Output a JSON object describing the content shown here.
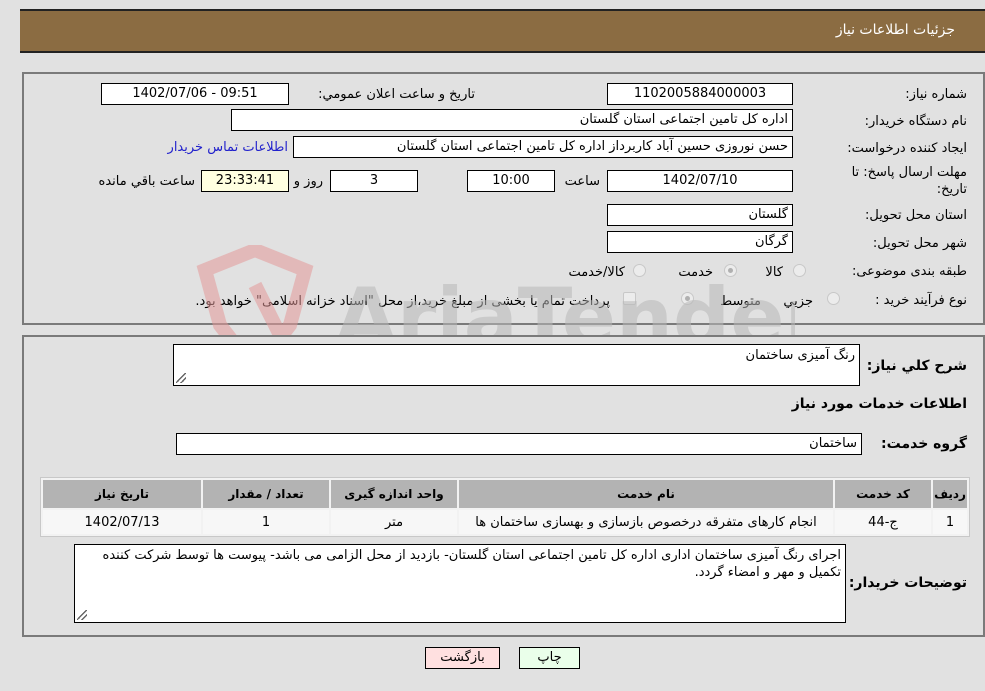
{
  "header": {
    "title": "جزئيات اطلاعات نياز"
  },
  "details": {
    "need_number_label": "شماره نياز:",
    "need_number": "1102005884000003",
    "announce_label": "تاريخ و ساعت اعلان عمومي:",
    "announce_value": "1402/07/06 - 09:51",
    "buyer_org_label": "نام دستگاه خريدار:",
    "buyer_org": "اداره کل تامین اجتماعی استان گلستان",
    "creator_label": "ايجاد کننده درخواست:",
    "creator": "حسن نوروزی حسین آباد کاربرداز اداره کل تامین اجتماعی استان گلستان",
    "contact_link": "اطلاعات تماس خريدار",
    "deadline_label_1": "مهلت ارسال پاسخ: تا",
    "deadline_label_2": "تاريخ:",
    "deadline_date": "1402/07/10",
    "time_label": "ساعت",
    "deadline_time": "10:00",
    "days_value": "3",
    "days_label": "روز و",
    "remaining_time": "23:33:41",
    "remaining_label": "ساعت باقي مانده",
    "province_label": "استان محل تحويل:",
    "province": "گلستان",
    "city_label": "شهر محل تحويل:",
    "city": "گرگان",
    "category_label": "طبقه بندی موضوعی:",
    "category_options": [
      "کالا",
      "خدمت",
      "کالا/خدمت"
    ],
    "category_selected": "خدمت",
    "process_label": "نوع فرآيند خريد :",
    "process_options": [
      "جزيي",
      "متوسط"
    ],
    "process_selected": "متوسط",
    "treasury_note": "پرداخت تمام يا بخشی از مبلغ خريد،از محل \"اسناد خزانه اسلامی\" خواهد بود."
  },
  "summary": {
    "general_desc_label": "شرح کلي نياز:",
    "general_desc": "رنگ آمیزی ساختمان",
    "services_heading": "اطلاعات خدمات مورد نياز",
    "service_group_label": "گروه خدمت:",
    "service_group": "ساختمان"
  },
  "table": {
    "columns": [
      "رديف",
      "کد خدمت",
      "نام خدمت",
      "واحد اندازه گيری",
      "تعداد / مقدار",
      "تاريخ نياز"
    ],
    "rows": [
      [
        "1",
        "ج-44",
        "انجام کارهای متفرقه درخصوص بازسازی و بهسازی ساختمان ها",
        "متر",
        "1",
        "1402/07/13"
      ]
    ]
  },
  "buyer_notes": {
    "label": "توضيحات خريدار:",
    "text": "اجرای رنگ آمیزی ساختمان اداری اداره کل تامین اجتماعی استان گلستان- بازدید از محل الزامی می باشد- پیوست ها توسط شرکت کننده تکمیل و مهر و امضاء گردد."
  },
  "buttons": {
    "back": "بازگشت",
    "print": "چاپ"
  },
  "watermark": {
    "text": "AriaTender.neT"
  }
}
